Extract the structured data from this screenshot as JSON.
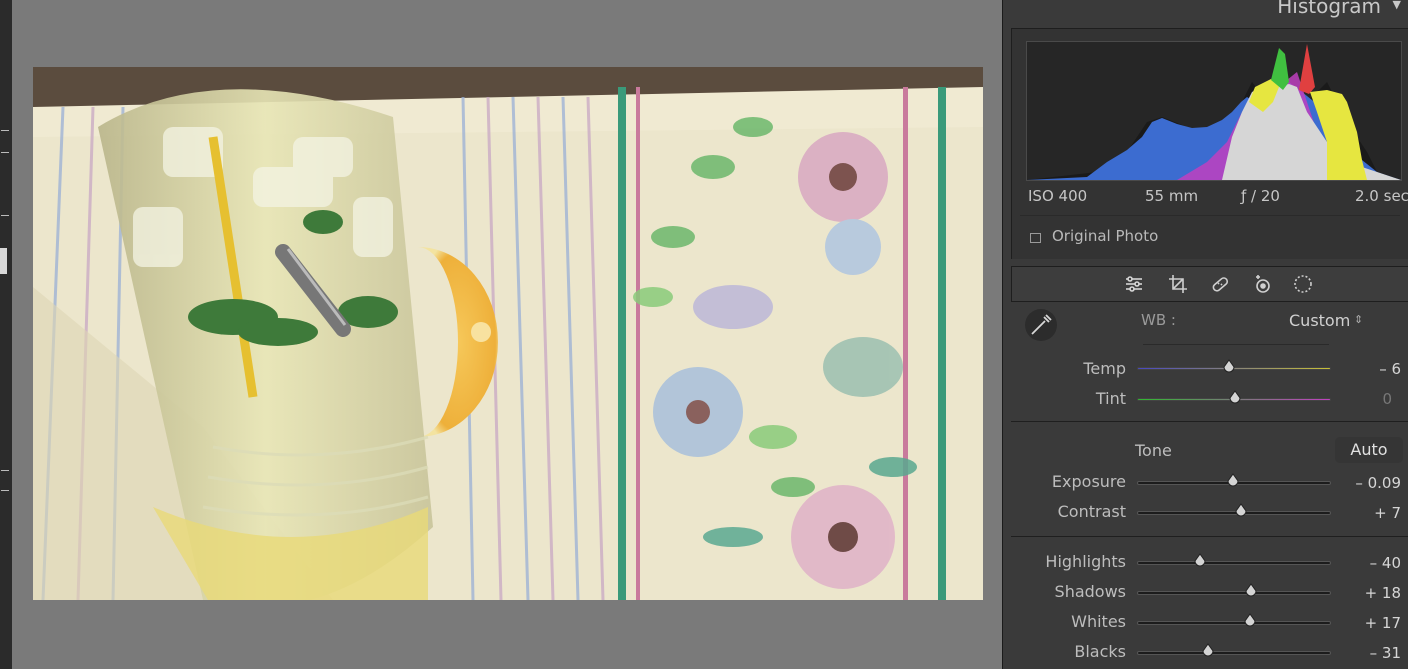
{
  "histogram": {
    "title": "Histogram",
    "exif": {
      "iso": "ISO 400",
      "focal_length": "55 mm",
      "aperture": "ƒ / 20",
      "shutter": "2.0 sec"
    },
    "original_photo_label": "Original Photo",
    "colors": {
      "shadow_clip": "#10109a",
      "highlight_clip": "#0a0a0a"
    }
  },
  "toolbar": {
    "icons": [
      "edit-sliders-icon",
      "crop-icon",
      "healing-icon",
      "red-eye-icon",
      "masking-icon"
    ]
  },
  "white_balance": {
    "label": "WB :",
    "value": "Custom",
    "sliders": [
      {
        "name": "temp",
        "label": "Temp",
        "value_text": "– 6",
        "value": -6,
        "position": 0.47
      },
      {
        "name": "tint",
        "label": "Tint",
        "value_text": "0",
        "value": 0,
        "position": 0.5
      }
    ]
  },
  "tone": {
    "label": "Tone",
    "auto_label": "Auto",
    "sliders": [
      {
        "name": "exposure",
        "label": "Exposure",
        "value_text": "– 0.09",
        "value": -0.09,
        "position": 0.49
      },
      {
        "name": "contrast",
        "label": "Contrast",
        "value_text": "+ 7",
        "value": 7,
        "position": 0.53
      }
    ],
    "presence_sliders": [
      {
        "name": "highlights",
        "label": "Highlights",
        "value_text": "– 40",
        "value": -40,
        "position": 0.32
      },
      {
        "name": "shadows",
        "label": "Shadows",
        "value_text": "+ 18",
        "value": 18,
        "position": 0.58
      },
      {
        "name": "whites",
        "label": "Whites",
        "value_text": "+ 17",
        "value": 17,
        "position": 0.575
      },
      {
        "name": "blacks",
        "label": "Blacks",
        "value_text": "– 31",
        "value": -31,
        "position": 0.36
      }
    ]
  }
}
